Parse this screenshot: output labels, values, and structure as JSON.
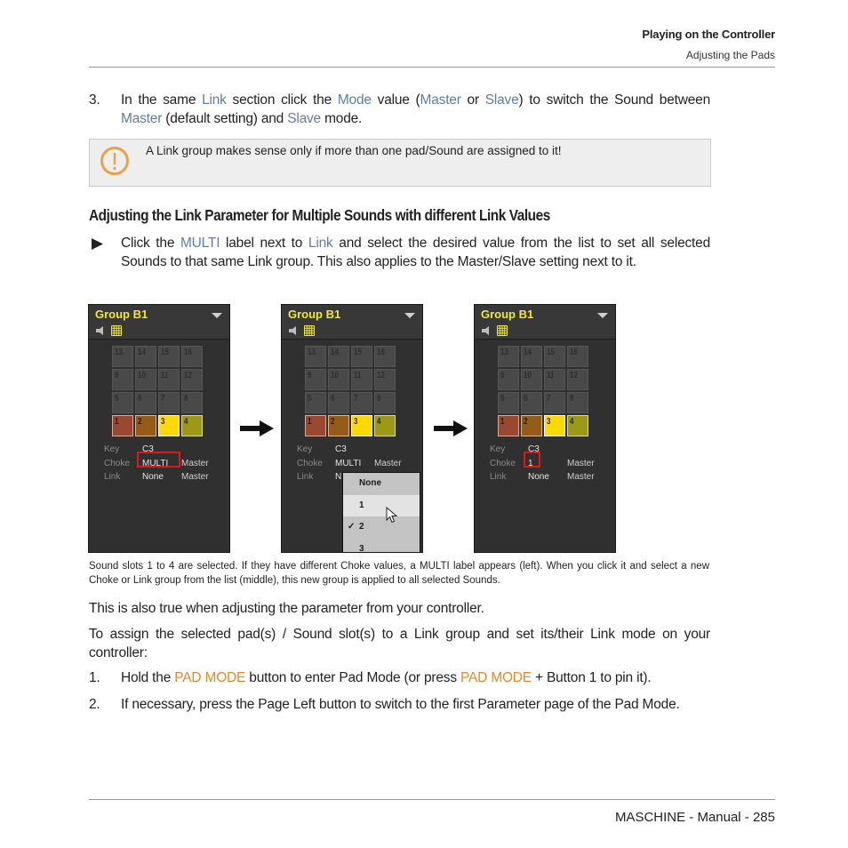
{
  "header": {
    "chapter": "Playing on the Controller",
    "section": "Adjusting the Pads"
  },
  "step3": {
    "number": "3.",
    "parts": [
      {
        "t": "In the same ",
        "s": "plain"
      },
      {
        "t": "Link",
        "s": "link"
      },
      {
        "t": " section click the ",
        "s": "plain"
      },
      {
        "t": "Mode",
        "s": "link"
      },
      {
        "t": " value (",
        "s": "plain"
      },
      {
        "t": "Master",
        "s": "link"
      },
      {
        "t": " or ",
        "s": "plain"
      },
      {
        "t": "Slave",
        "s": "link"
      },
      {
        "t": ") to switch the Sound be­tween ",
        "s": "plain"
      },
      {
        "t": "Master",
        "s": "link"
      },
      {
        "t": " (default setting) and ",
        "s": "plain"
      },
      {
        "t": "Slave",
        "s": "link"
      },
      {
        "t": " mode.",
        "s": "plain"
      }
    ]
  },
  "note": {
    "icon": "warning-exclamation-icon",
    "text": "A Link group makes sense only if more than one pad/Sound are assigned to it!",
    "icon_color": "#e8a34a"
  },
  "section_heading": "Adjusting the Link Parameter for Multiple Sounds with different Link Values",
  "bullet": {
    "icon": "triangle-bullet-icon",
    "parts": [
      {
        "t": "Click the ",
        "s": "plain"
      },
      {
        "t": "MULTI",
        "s": "link"
      },
      {
        "t": " label next to ",
        "s": "plain"
      },
      {
        "t": "Link",
        "s": "link"
      },
      {
        "t": " and select the desired value from the list to set all selected Sounds to that same Link group. This also applies to the Master/Slave setting next to it.",
        "s": "plain"
      }
    ]
  },
  "figure": {
    "panels": [
      {
        "title": "Group B1",
        "pads": [
          "13",
          "14",
          "15",
          "16",
          "9",
          "10",
          "11",
          "12",
          "5",
          "6",
          "7",
          "8",
          "1",
          "2",
          "3",
          "4"
        ],
        "params": [
          {
            "label": "Key",
            "value": "C3",
            "mode": ""
          },
          {
            "label": "Choke",
            "value": "MULTI",
            "mode": "Master"
          },
          {
            "label": "Link",
            "value": "None",
            "mode": "Master"
          }
        ]
      },
      {
        "title": "Group B1",
        "pads": [
          "13",
          "14",
          "15",
          "16",
          "9",
          "10",
          "11",
          "12",
          "5",
          "6",
          "7",
          "8",
          "1",
          "2",
          "3",
          "4"
        ],
        "params": [
          {
            "label": "Key",
            "value": "C3",
            "mode": ""
          },
          {
            "label": "Choke",
            "value": "MULTI",
            "mode": "Master"
          },
          {
            "label": "Link",
            "value": "N",
            "mode": ""
          }
        ],
        "dropdown": {
          "items": [
            {
              "label": "None",
              "checked": false,
              "hover": false
            },
            {
              "label": "1",
              "checked": false,
              "hover": true
            },
            {
              "label": "2",
              "checked": true,
              "hover": false
            },
            {
              "label": "3",
              "checked": false,
              "hover": false
            }
          ],
          "check_glyph": "✓"
        }
      },
      {
        "title": "Group B1",
        "pads": [
          "13",
          "14",
          "15",
          "16",
          "9",
          "10",
          "11",
          "12",
          "5",
          "6",
          "7",
          "8",
          "1",
          "2",
          "3",
          "4"
        ],
        "params": [
          {
            "label": "Key",
            "value": "C3",
            "mode": ""
          },
          {
            "label": "Choke",
            "value": "1",
            "mode": "Master"
          },
          {
            "label": "Link",
            "value": "None",
            "mode": "Master"
          }
        ]
      }
    ],
    "pad_colors": {
      "pad1": "#9b4830",
      "pad2": "#955b17",
      "pad3": "#ffd900",
      "pad4": "#9a9a17",
      "inactive": "#494949"
    },
    "title_color": "#f2e92a",
    "highlight_color": "#e0161c",
    "caption": "Sound slots 1 to 4 are selected. If they have different Choke values, a MULTI label appears (left). When you click it and select a new Choke or Link group from the list (middle), this new group is applied to all selected Sounds."
  },
  "para1": "This is also true when adjusting the parameter from your controller.",
  "para2": "To assign the selected pad(s) / Sound slot(s) to a Link group and set its/their Link mode on your controller:",
  "steps": [
    {
      "number": "1.",
      "parts": [
        {
          "t": "Hold the ",
          "s": "plain"
        },
        {
          "t": "PAD MODE",
          "s": "orange"
        },
        {
          "t": " button to enter Pad Mode (or press ",
          "s": "plain"
        },
        {
          "t": "PAD MODE",
          "s": "orange"
        },
        {
          "t": " + Button 1 to pin it).",
          "s": "plain"
        }
      ]
    },
    {
      "number": "2.",
      "parts": [
        {
          "t": "If necessary, press the Page Left button to switch to the first Parameter page of the Pad Mode.",
          "s": "plain"
        }
      ]
    }
  ],
  "footer": "MASCHINE - Manual - 285",
  "colors": {
    "link": "#5e7da6",
    "orange": "#e8872a"
  }
}
